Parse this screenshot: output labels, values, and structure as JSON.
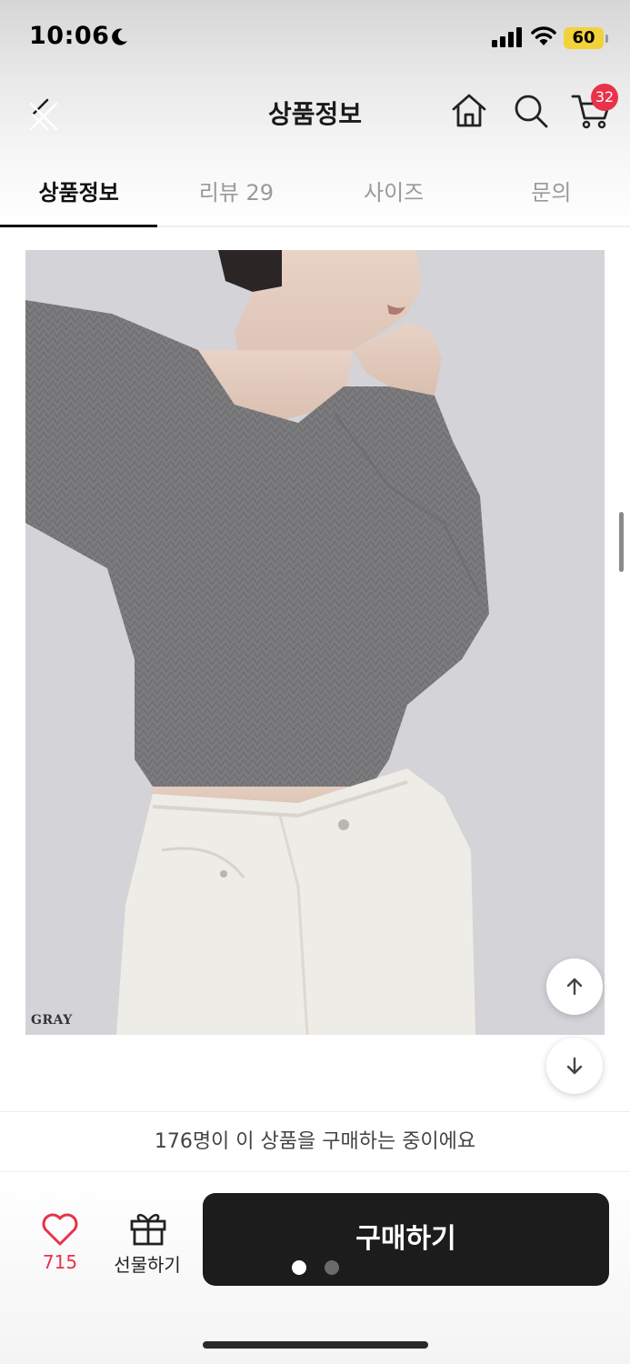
{
  "status_bar": {
    "time": "10:06",
    "battery": "60",
    "icons": [
      "moon-icon",
      "signal-icon",
      "wifi-icon",
      "battery-icon"
    ]
  },
  "header": {
    "title": "상품정보",
    "cart_count": "32",
    "icons": [
      "back-icon",
      "home-icon",
      "search-icon",
      "cart-icon"
    ]
  },
  "tabs": [
    {
      "label": "상품정보",
      "active": true
    },
    {
      "label": "리뷰 29",
      "active": false
    },
    {
      "label": "사이즈",
      "active": false
    },
    {
      "label": "문의",
      "active": false
    }
  ],
  "product": {
    "color_label": "GRAY",
    "image_description_colors": {
      "background": "#d4d3d8",
      "sweater": "#7c7c7e",
      "jeans": "#eeece6"
    }
  },
  "notice": {
    "text": "176명이 이 상품을 구매하는 중이에요"
  },
  "bottom_bar": {
    "like_count": "715",
    "gift_label": "선물하기",
    "buy_label": "구매하기",
    "accent_color": "#e8334a",
    "page_indicator": {
      "current": 1,
      "total": 2
    }
  }
}
